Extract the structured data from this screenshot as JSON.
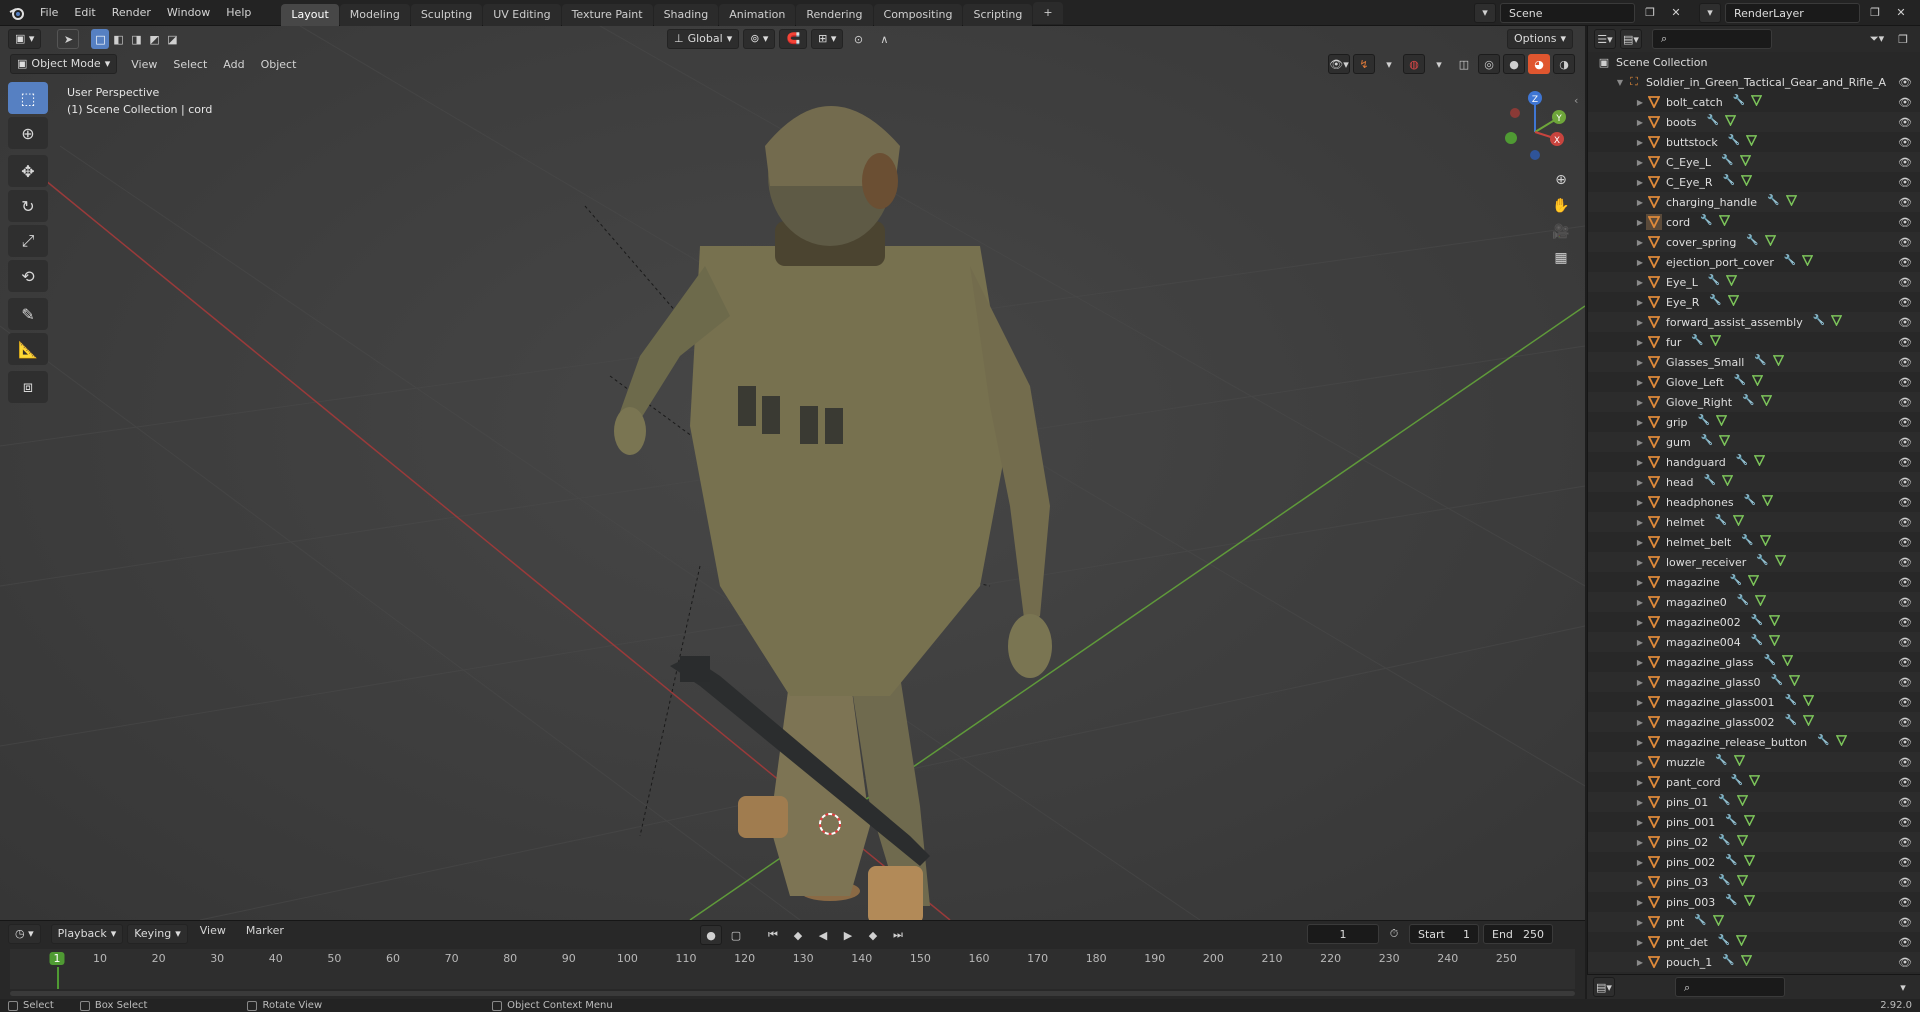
{
  "topbar": {
    "menus": [
      "File",
      "Edit",
      "Render",
      "Window",
      "Help"
    ],
    "workspaces": [
      "Layout",
      "Modeling",
      "Sculpting",
      "UV Editing",
      "Texture Paint",
      "Shading",
      "Animation",
      "Rendering",
      "Compositing",
      "Scripting"
    ],
    "active_workspace": "Layout",
    "add_tab": "+",
    "scene": "Scene",
    "view_layer": "RenderLayer"
  },
  "viewport": {
    "mode": "Object Mode",
    "menus": [
      "View",
      "Select",
      "Add",
      "Object"
    ],
    "transform_orientation": "Global",
    "options_label": "Options",
    "overlay_title": "User Perspective",
    "overlay_subtitle": "(1) Scene Collection | cord",
    "gizmo_axes": {
      "x": "X",
      "y": "Y",
      "z": "Z"
    },
    "colors": {
      "x_axis": "#c8443e",
      "y_axis": "#6ea63a",
      "z_axis": "#3f76d4"
    }
  },
  "outliner": {
    "root": "Scene Collection",
    "collection": "Soldier_in_Green_Tactical_Gear_and_Rifle_A",
    "items": [
      "bolt_catch",
      "boots",
      "buttstock",
      "C_Eye_L",
      "C_Eye_R",
      "charging_handle",
      "cord",
      "cover_spring",
      "ejection_port_cover",
      "Eye_L",
      "Eye_R",
      "forward_assist_assembly",
      "fur",
      "Glasses_Small",
      "Glove_Left",
      "Glove_Right",
      "grip",
      "gum",
      "handguard",
      "head",
      "headphones",
      "helmet",
      "helmet_belt",
      "lower_receiver",
      "magazine",
      "magazine0",
      "magazine002",
      "magazine004",
      "magazine_glass",
      "magazine_glass0",
      "magazine_glass001",
      "magazine_glass002",
      "magazine_release_button",
      "muzzle",
      "pant_cord",
      "pins_01",
      "pins_001",
      "pins_02",
      "pins_002",
      "pins_03",
      "pins_003",
      "pnt",
      "pnt_det",
      "pouch_1"
    ],
    "selected": "cord"
  },
  "timeline": {
    "menus": [
      "Playback",
      "Keying",
      "View",
      "Marker"
    ],
    "current_frame": "1",
    "start_label": "Start",
    "start": "1",
    "end_label": "End",
    "end": "250",
    "ruler": [
      "1",
      "10",
      "20",
      "30",
      "40",
      "50",
      "60",
      "70",
      "80",
      "90",
      "100",
      "110",
      "120",
      "130",
      "140",
      "150",
      "160",
      "170",
      "180",
      "190",
      "200",
      "210",
      "220",
      "230",
      "240",
      "250"
    ]
  },
  "statusbar": {
    "select": "Select",
    "box_select": "Box Select",
    "rotate_view": "Rotate View",
    "context_menu": "Object Context Menu",
    "version": "2.92.0"
  }
}
